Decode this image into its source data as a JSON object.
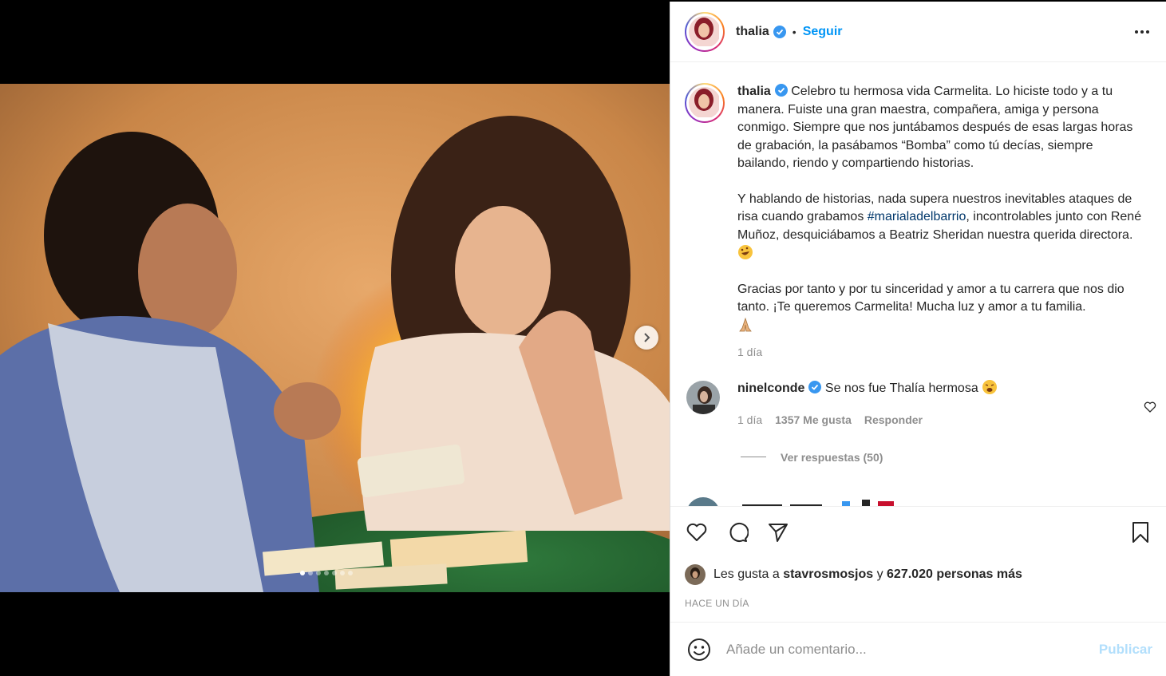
{
  "post": {
    "author": "thalia",
    "follow_label": "Seguir",
    "dot": "•",
    "more_icon": "more-horizontal-icon"
  },
  "caption": {
    "username": "thalia",
    "paragraph1": "Celebro tu hermosa vida Carmelita. Lo hiciste todo y a tu manera. Fuiste una gran maestra, compañera, amiga y persona conmigo. Siempre que nos juntábamos después de esas largas horas de grabación, la pasábamos “Bomba” como tú decías, siempre bailando, riendo y compartiendo historias.",
    "paragraph2_before": "Y hablando de historias, nada supera nuestros inevitables ataques de risa cuando grabamos ",
    "hashtag": "#marialadelbarrio",
    "paragraph2_after": ", incontrolables junto con René Muñoz, desquiciábamos a Beatriz Sheridan nuestra querida directora.",
    "paragraph3": "Gracias por tanto y por tu sinceridad y amor a tu carrera que nos dio tanto. ¡Te queremos Carmelita! Mucha luz y amor a tu familia.",
    "time": "1 día"
  },
  "comment": {
    "username": "ninelconde",
    "text": "Se nos fue Thalía hermosa",
    "time": "1 día",
    "likes": "1357 Me gusta",
    "reply": "Responder",
    "view_replies": "Ver respuestas (50)"
  },
  "likes": {
    "prefix": "Les gusta a",
    "user": "stavrosmosjos",
    "connector": "y",
    "count": "627.020 personas más"
  },
  "posted": "HACE UN DÍA",
  "composer": {
    "placeholder": "Añade un comentario...",
    "publish": "Publicar"
  },
  "carousel": {
    "total_slides": 7,
    "active_slide": 1
  },
  "colors": {
    "link": "#0095f6",
    "hashtag": "#00376b",
    "secondary": "#8e8e8e",
    "publish_disabled": "#b2dffc"
  }
}
